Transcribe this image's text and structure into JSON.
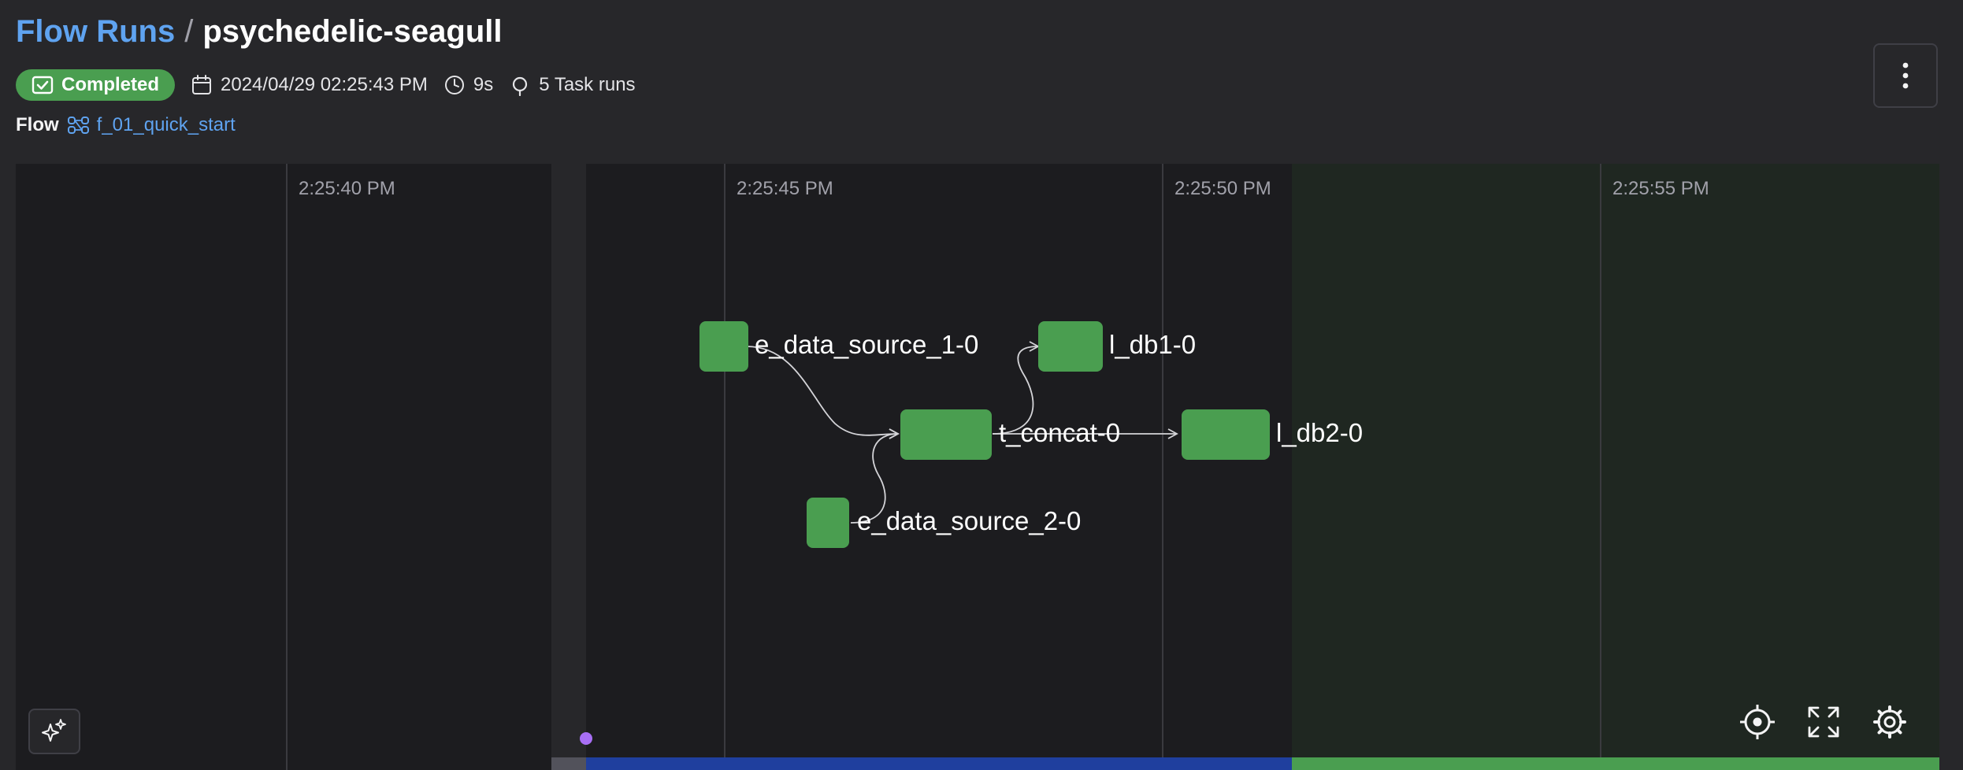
{
  "breadcrumb": {
    "parent": "Flow Runs",
    "separator": "/",
    "current": "psychedelic-seagull"
  },
  "status": {
    "label": "Completed",
    "color": "#4a9e50"
  },
  "meta": {
    "start_time": "2024/04/29 02:25:43 PM",
    "duration": "9s",
    "task_runs": "5 Task runs"
  },
  "flow": {
    "label": "Flow",
    "name": "f_01_quick_start"
  },
  "timeline": {
    "ticks": [
      "2:25:40 PM",
      "2:25:45 PM",
      "2:25:50 PM",
      "2:25:55 PM"
    ],
    "nodes": [
      {
        "label": "e_data_source_1-0"
      },
      {
        "label": "t_concat-0"
      },
      {
        "label": "e_data_source_2-0"
      },
      {
        "label": "l_db1-0"
      },
      {
        "label": "l_db2-0"
      }
    ]
  },
  "icons": {
    "menu": "more-vertical-icon",
    "calendar": "calendar-icon",
    "clock": "clock-icon",
    "task": "task-run-icon",
    "flow": "flow-icon",
    "ai": "sparkles-icon",
    "center": "crosshair-icon",
    "fullscreen": "expand-icon",
    "settings": "gear-icon"
  },
  "colors": {
    "accent": "#5fa3f0",
    "success": "#4a9e50",
    "running": "#1f3f9e",
    "marker": "#a86ff5"
  }
}
